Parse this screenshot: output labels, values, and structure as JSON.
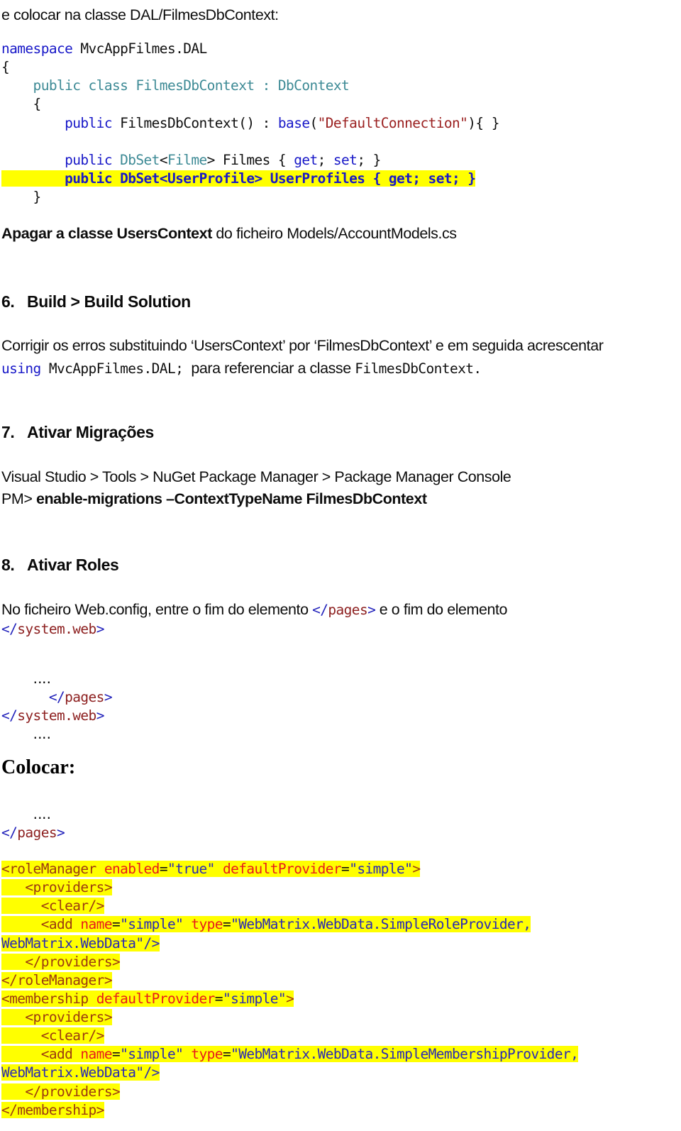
{
  "document": {
    "intro_line": "e colocar na classe DAL/FilmesDbContext:",
    "csharp_block": {
      "language": "csharp",
      "lines": [
        {
          "tokens": [
            {
              "t": "namespace ",
              "c": "kw"
            },
            {
              "t": "MvcAppFilmes.DAL",
              "c": "plain"
            }
          ]
        },
        {
          "tokens": [
            {
              "t": "{",
              "c": "plain"
            }
          ]
        },
        {
          "tokens": [
            {
              "t": "    public class FilmesDbContext : DbContext",
              "c": "type"
            }
          ]
        },
        {
          "tokens": [
            {
              "t": "    {",
              "c": "plain"
            }
          ]
        },
        {
          "tokens": [
            {
              "t": "        ",
              "c": "plain"
            },
            {
              "t": "public",
              "c": "kw"
            },
            {
              "t": " FilmesDbContext() : ",
              "c": "plain"
            },
            {
              "t": "base",
              "c": "kw"
            },
            {
              "t": "(",
              "c": "plain"
            },
            {
              "t": "\"DefaultConnection\"",
              "c": "str"
            },
            {
              "t": "){ }",
              "c": "plain"
            }
          ]
        },
        {
          "tokens": [
            {
              "t": "",
              "c": "plain"
            }
          ]
        },
        {
          "tokens": [
            {
              "t": "        ",
              "c": "plain"
            },
            {
              "t": "public",
              "c": "kw"
            },
            {
              "t": " ",
              "c": "plain"
            },
            {
              "t": "DbSet",
              "c": "type"
            },
            {
              "t": "<",
              "c": "plain"
            },
            {
              "t": "Filme",
              "c": "type"
            },
            {
              "t": "> Filmes { ",
              "c": "plain"
            },
            {
              "t": "get",
              "c": "kw"
            },
            {
              "t": "; ",
              "c": "plain"
            },
            {
              "t": "set",
              "c": "kw"
            },
            {
              "t": "; }",
              "c": "plain"
            }
          ]
        },
        {
          "highlight": true,
          "bold": true,
          "tokens": [
            {
              "t": "        public DbSet<UserProfile> UserProfiles { get; set; }",
              "c": "kw"
            }
          ]
        },
        {
          "tokens": [
            {
              "t": "    }",
              "c": "plain"
            }
          ]
        }
      ]
    },
    "apagar_line": {
      "bold_part": "Apagar a classe UsersContext",
      "rest": " do ficheiro Models/AccountModels.cs"
    },
    "step6": {
      "number": "6.",
      "title": "Build  >  Build Solution"
    },
    "corrigir": {
      "line1": "Corrigir os erros substituindo ‘UsersContext’ por ‘FilmesDbContext’ e em seguida acrescentar",
      "line2_kw": "using",
      "line2_code": " MvcAppFilmes.DAL; ",
      "line2_mid": " para referenciar a classe ",
      "line2_code2": "FilmesDbContext."
    },
    "step7": {
      "number": "7.",
      "title": "Ativar Migrações",
      "path_line": "Visual Studio > Tools  >  NuGet Package Manager >  Package Manager Console",
      "pm_prefix": "PM> ",
      "pm_command": "enable-migrations –ContextTypeName FilmesDbContext"
    },
    "step8": {
      "number": "8.",
      "title": "Ativar Roles",
      "desc_a": "No ficheiro Web.config, entre o fim do elemento ",
      "desc_tag1": "</pages>",
      "desc_b": "  e o fim do elemento",
      "desc_tag2": "</system.web>"
    },
    "existing_snippet": {
      "lines": [
        {
          "indent": 2,
          "kind": "dots",
          "text": "‥‥"
        },
        {
          "indent": 3,
          "kind": "tag",
          "text": "</pages>"
        },
        {
          "indent": 0,
          "kind": "tag",
          "text": "</system.web>"
        },
        {
          "indent": 2,
          "kind": "dots",
          "text": "‥‥"
        }
      ]
    },
    "colocar_heading": "Colocar:",
    "after_snippet": {
      "lines": [
        {
          "indent": 2,
          "kind": "dots",
          "text": "‥‥"
        },
        {
          "indent": 0,
          "kind": "tag",
          "text": "</pages>"
        }
      ]
    },
    "xml_block": {
      "language": "xml",
      "lines": [
        {
          "hl": true,
          "tokens": [
            {
              "t": "<roleManager ",
              "c": "xtag"
            },
            {
              "t": "enabled",
              "c": "xattr"
            },
            {
              "t": "=",
              "c": "plain"
            },
            {
              "t": "\"true\"",
              "c": "xval"
            },
            {
              "t": " ",
              "c": "plain"
            },
            {
              "t": "defaultProvider",
              "c": "xattr"
            },
            {
              "t": "=",
              "c": "plain"
            },
            {
              "t": "\"simple\"",
              "c": "xval"
            },
            {
              "t": ">",
              "c": "xtag"
            }
          ]
        },
        {
          "hl": true,
          "tokens": [
            {
              "t": "   <providers>",
              "c": "xtag"
            }
          ]
        },
        {
          "hl": true,
          "tokens": [
            {
              "t": "     <clear/>",
              "c": "xtag"
            }
          ]
        },
        {
          "hl": true,
          "tokens": [
            {
              "t": "     <add ",
              "c": "xtag"
            },
            {
              "t": "name",
              "c": "xattr"
            },
            {
              "t": "=",
              "c": "plain"
            },
            {
              "t": "\"simple\"",
              "c": "xval"
            },
            {
              "t": " ",
              "c": "plain"
            },
            {
              "t": "type",
              "c": "xattr"
            },
            {
              "t": "=",
              "c": "plain"
            },
            {
              "t": "\"WebMatrix.WebData.SimpleRoleProvider,",
              "c": "xval"
            }
          ]
        },
        {
          "hl": true,
          "tokens": [
            {
              "t": "WebMatrix.WebData\"/>",
              "c": "xval"
            }
          ]
        },
        {
          "hl": true,
          "tokens": [
            {
              "t": "   </providers>",
              "c": "xtag"
            }
          ]
        },
        {
          "hl": true,
          "tokens": [
            {
              "t": "</roleManager>",
              "c": "xtag"
            }
          ]
        },
        {
          "hl": true,
          "tokens": [
            {
              "t": "<membership ",
              "c": "xtag"
            },
            {
              "t": "defaultProvider",
              "c": "xattr"
            },
            {
              "t": "=",
              "c": "plain"
            },
            {
              "t": "\"simple\"",
              "c": "xval"
            },
            {
              "t": ">",
              "c": "xtag"
            }
          ]
        },
        {
          "hl": true,
          "tokens": [
            {
              "t": "   <providers>",
              "c": "xtag"
            }
          ]
        },
        {
          "hl": true,
          "tokens": [
            {
              "t": "     <clear/>",
              "c": "xtag"
            }
          ]
        },
        {
          "hl": true,
          "tokens": [
            {
              "t": "     <add ",
              "c": "xtag"
            },
            {
              "t": "name",
              "c": "xattr"
            },
            {
              "t": "=",
              "c": "plain"
            },
            {
              "t": "\"simple\"",
              "c": "xval"
            },
            {
              "t": " ",
              "c": "plain"
            },
            {
              "t": "type",
              "c": "xattr"
            },
            {
              "t": "=",
              "c": "plain"
            },
            {
              "t": "\"WebMatrix.WebData.SimpleMembershipProvider,",
              "c": "xval"
            }
          ]
        },
        {
          "hl": true,
          "tokens": [
            {
              "t": "WebMatrix.WebData\"/>",
              "c": "xval"
            }
          ]
        },
        {
          "hl": true,
          "tokens": [
            {
              "t": "   </providers>",
              "c": "xtag"
            }
          ]
        },
        {
          "hl": true,
          "tokens": [
            {
              "t": "</membership>",
              "c": "xtag"
            }
          ]
        }
      ]
    }
  },
  "colors": {
    "highlight": "#ffff00",
    "keyword_blue": "#1818c8",
    "type_teal": "#3d8a95",
    "string_red": "#9b2020",
    "xml_tag": "#9c3a10",
    "xml_attr": "#e81b1b",
    "xml_value": "#2a2ab5",
    "text": "#0d0d0d"
  }
}
